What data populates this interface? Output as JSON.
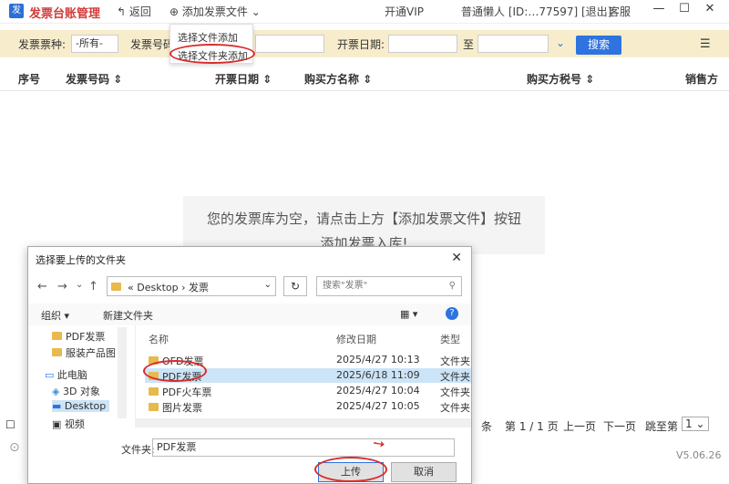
{
  "app": {
    "title": "发票台账管理",
    "back_label": "返回",
    "add_label": "添加发票文件",
    "vip_label": "开通VIP",
    "user_label": "普通懒人 [ID:…77597] [退出]",
    "service_label": "客服",
    "version": "V5.06.26"
  },
  "add_menu": {
    "items": [
      "选择文件添加",
      "选择文件夹添加"
    ]
  },
  "filters": {
    "type_label": "发票票种:",
    "type_value": "-所有-",
    "number_label": "发票号码",
    "date_label": "开票日期:",
    "to_label": "至",
    "search_label": "搜索"
  },
  "table": {
    "headers": [
      "序号",
      "发票号码",
      "开票日期",
      "购买方名称",
      "购买方税号",
      "销售方"
    ]
  },
  "empty": {
    "line1": "您的发票库为空，请点击上方【添加发票文件】按钮",
    "line2": "添加发票入库!"
  },
  "pager": {
    "count_suffix": "条",
    "page_info": "第 1 / 1 页",
    "prev": "上一页",
    "next": "下一页",
    "jump": "跳至第",
    "jump_value": "1"
  },
  "dialog": {
    "title": "选择要上传的文件夹",
    "path": [
      "Desktop",
      "发票"
    ],
    "search_placeholder": "搜索\"发票\"",
    "organize": "组织",
    "new_folder": "新建文件夹",
    "nav_items": [
      "PDF发票",
      "服装产品图",
      "此电脑",
      "3D 对象",
      "Desktop",
      "视频"
    ],
    "columns": {
      "name": "名称",
      "date": "修改日期",
      "type": "类型"
    },
    "rows": [
      {
        "name": "OFD发票",
        "date": "2025/4/27 10:13",
        "type": "文件夹"
      },
      {
        "name": "PDF发票",
        "date": "2025/6/18 11:09",
        "type": "文件夹"
      },
      {
        "name": "PDF火车票",
        "date": "2025/4/27 10:04",
        "type": "文件夹"
      },
      {
        "name": "图片发票",
        "date": "2025/4/27 10:05",
        "type": "文件夹"
      }
    ],
    "folder_label": "文件夹:",
    "folder_value": "PDF发票",
    "upload": "上传",
    "cancel": "取消"
  },
  "colors": {
    "accent": "#2e73e0",
    "filterbar": "#f7edcc",
    "highlight": "#d92b2b"
  }
}
